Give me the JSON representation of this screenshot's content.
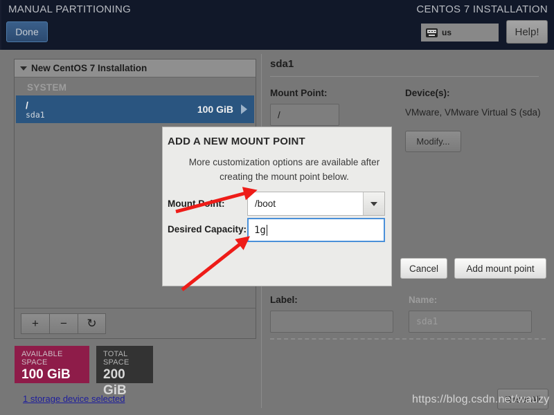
{
  "header": {
    "title_left": "MANUAL PARTITIONING",
    "title_right": "CENTOS 7 INSTALLATION",
    "done_label": "Done",
    "keyboard_layout": "us",
    "keyboard_icon": "keyboard-icon",
    "help_label": "Help!"
  },
  "left_panel": {
    "group_title": "New CentOS 7 Installation",
    "section_label": "SYSTEM",
    "rows": [
      {
        "mount": "/",
        "device": "sda1",
        "size": "100 GiB"
      }
    ],
    "toolbar": {
      "add": "+",
      "remove": "−",
      "refresh": "↻"
    },
    "available_space_caption": "AVAILABLE SPACE",
    "available_space_value": "100 GiB",
    "total_space_caption": "TOTAL SPACE",
    "total_space_value": "200 GiB",
    "storage_link": "1 storage device selected"
  },
  "right_panel": {
    "title": "sda1",
    "mount_point_label": "Mount Point:",
    "mount_point_value": "/",
    "devices_label": "Device(s):",
    "devices_value": "VMware, VMware Virtual S (sda)",
    "modify_label": "Modify...",
    "label_label": "Label:",
    "label_value": "",
    "name_label": "Name:",
    "name_value": "sda1",
    "reset_label": "Reset All"
  },
  "dialog": {
    "title": "ADD A NEW MOUNT POINT",
    "subtitle": "More customization options are available after creating the mount point below.",
    "mount_point_label": "Mount Point:",
    "mount_point_value": "/boot",
    "desired_capacity_label": "Desired Capacity:",
    "desired_capacity_value": "1g",
    "cancel_label": "Cancel",
    "add_label": "Add mount point"
  },
  "watermark": {
    "text": "https://blog.csdn.net/wauzy"
  },
  "colors": {
    "header_bg": "#12192b",
    "page_bg": "#777777",
    "selected_row": "#2a5580",
    "available_space": "#8e1c49",
    "total_space": "#333333",
    "focus_border": "#4a90d9",
    "link": "#1d1d9c",
    "annotation_arrow": "#ee1c18"
  }
}
